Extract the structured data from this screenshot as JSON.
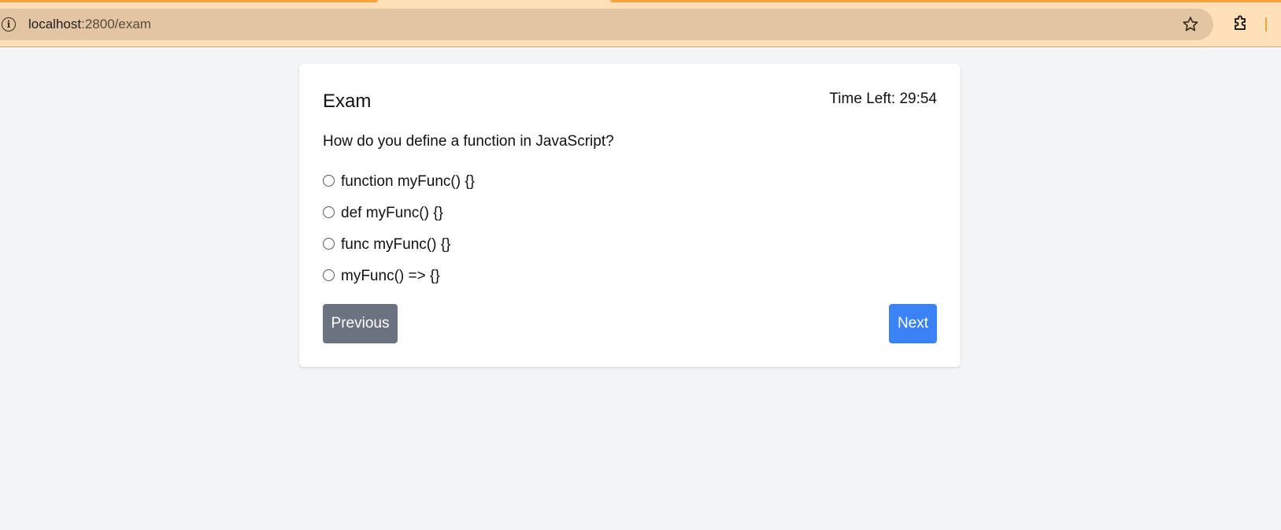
{
  "browser": {
    "url_host": "localhost",
    "url_path": ":2800/exam",
    "icons": [
      "info-icon",
      "star-icon",
      "extensions-icon"
    ]
  },
  "exam": {
    "title": "Exam",
    "timer": "Time Left: 29:54",
    "question": "How do you define a function in JavaScript?",
    "options": [
      "function myFunc() {}",
      "def myFunc() {}",
      "func myFunc() {}",
      "myFunc() => {}"
    ],
    "previous_label": "Previous",
    "next_label": "Next"
  },
  "colors": {
    "chrome_bg": "#ffe0b8",
    "omnibox_bg": "#e2c6a4",
    "page_bg": "#f3f4f6",
    "previous_button": "#6b7280",
    "next_button": "#3b82f6"
  }
}
